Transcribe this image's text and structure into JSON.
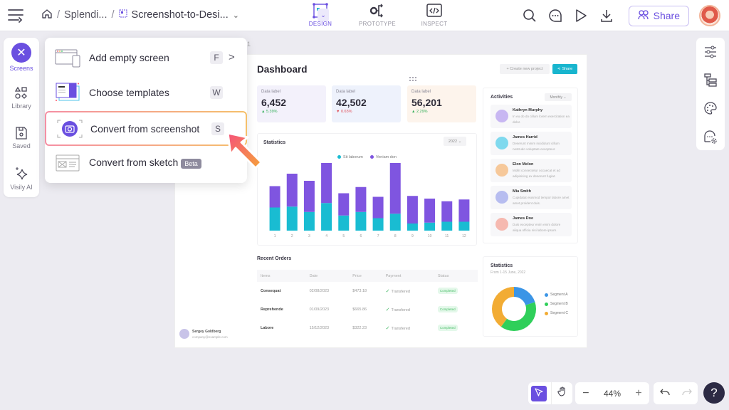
{
  "topbar": {
    "breadcrumb": [
      "Splendi...",
      "Screenshot-to-Desi..."
    ],
    "modes": [
      {
        "label": "DESIGN",
        "active": true
      },
      {
        "label": "PROTOTYPE",
        "active": false
      },
      {
        "label": "INSPECT",
        "active": false
      }
    ],
    "share_label": "Share"
  },
  "left_rail": [
    {
      "label": "Screens",
      "icon": "close-icon",
      "active": true
    },
    {
      "label": "Library",
      "icon": "shapes-icon"
    },
    {
      "label": "Saved",
      "icon": "saved-icon"
    },
    {
      "label": "Visily AI",
      "icon": "sparkle-icon"
    }
  ],
  "dropdown": {
    "items": [
      {
        "label": "Add empty screen",
        "shortcut": "F",
        "has_submenu": true
      },
      {
        "label": "Choose templates",
        "shortcut": "W"
      },
      {
        "label": "Convert from screenshot",
        "shortcut": "S",
        "highlighted": true
      },
      {
        "label": "Convert from sketch",
        "badge": "Beta"
      }
    ]
  },
  "canvas": {
    "frame_number": "1",
    "dashboard": {
      "title": "Dashboard",
      "create_label": "+  Create new project",
      "share_label": "Share",
      "stats": [
        {
          "label": "Data label",
          "value": "6,452",
          "change": "▲ 5.39%",
          "trend": "up",
          "bg": "#f3f1fb"
        },
        {
          "label": "Data label",
          "value": "42,502",
          "change": "▼ 0.65%",
          "trend": "down",
          "bg": "#eef2fc"
        },
        {
          "label": "Data label",
          "value": "56,201",
          "change": "▲ 2.29%",
          "trend": "up",
          "bg": "#fdf4ec"
        }
      ],
      "statistics": {
        "title": "Statistics",
        "year": "2022 ⌄"
      },
      "activities": {
        "title": "Activities",
        "filter": "Monthly ⌄",
        "items": [
          {
            "name": "Kathryn Murphy",
            "desc": "In eu do do cillum lorem exercitation ea dolor.",
            "color": "#c8b7f2"
          },
          {
            "name": "James Harrid",
            "desc": "Deserunt minim incididunt cillum nostrudo voluptate excepteur.",
            "color": "#7fd9ee"
          },
          {
            "name": "Elon Melon",
            "desc": "Mollit consectetur occaecat et ad adipisicing ex deserunt fugiat.",
            "color": "#f6c89a"
          },
          {
            "name": "Mia Smith",
            "desc": "Cupidatat eiusmod tempor labore amet amet proident duis.",
            "color": "#b7bdf0"
          },
          {
            "name": "James Doe",
            "desc": "Duis excepteur enim enim dolore aliqua officia nisi labore ipsum.",
            "color": "#f6b9b0"
          }
        ]
      },
      "orders": {
        "title": "Recent Orders",
        "columns": [
          "Items",
          "Date",
          "Price",
          "Payment",
          "Status"
        ],
        "rows": [
          {
            "item": "Consequat",
            "date": "02/08/2023",
            "price": "$473.18",
            "payment": "Transfered",
            "status": "Completed"
          },
          {
            "item": "Reprehende",
            "date": "01/09/2023",
            "price": "$665.86",
            "payment": "Transfered",
            "status": "Completed"
          },
          {
            "item": "Labore",
            "date": "15/12/2023",
            "price": "$322.23",
            "payment": "Transfered",
            "status": "Completed"
          }
        ]
      },
      "donut": {
        "title": "Statistics",
        "subtitle": "From 1-15 June, 2022"
      },
      "user": {
        "name": "Sergey Goldberg",
        "email": "company@example.com"
      }
    }
  },
  "bottom_bar": {
    "zoom": "44%",
    "help": "?"
  },
  "chart_data": [
    {
      "type": "bar",
      "stacked": true,
      "title": "Statistics",
      "categories": [
        "1",
        "2",
        "3",
        "4",
        "5",
        "6",
        "7",
        "8",
        "9",
        "10",
        "11",
        "12"
      ],
      "series": [
        {
          "name": "Sit laborum",
          "color": "#19bcd2",
          "values": [
            26,
            27,
            21,
            31,
            17,
            21,
            14,
            19,
            8,
            9,
            10,
            10
          ]
        },
        {
          "name": "Veniam don",
          "color": "#7f55e0",
          "values": [
            24,
            37,
            35,
            45,
            25,
            28,
            24,
            57,
            31,
            27,
            23,
            25
          ]
        }
      ],
      "ylim": [
        0,
        80
      ],
      "legend": "top-center"
    },
    {
      "type": "pie",
      "donut": true,
      "title": "Statistics",
      "subtitle": "From 1-15 June, 2022",
      "labels": [
        "Segment A",
        "Segment B",
        "Segment C"
      ],
      "values": [
        20,
        40,
        40
      ],
      "colors": [
        "#3b95e6",
        "#2fcf5a",
        "#f2ac34"
      ],
      "legend": "right"
    }
  ]
}
